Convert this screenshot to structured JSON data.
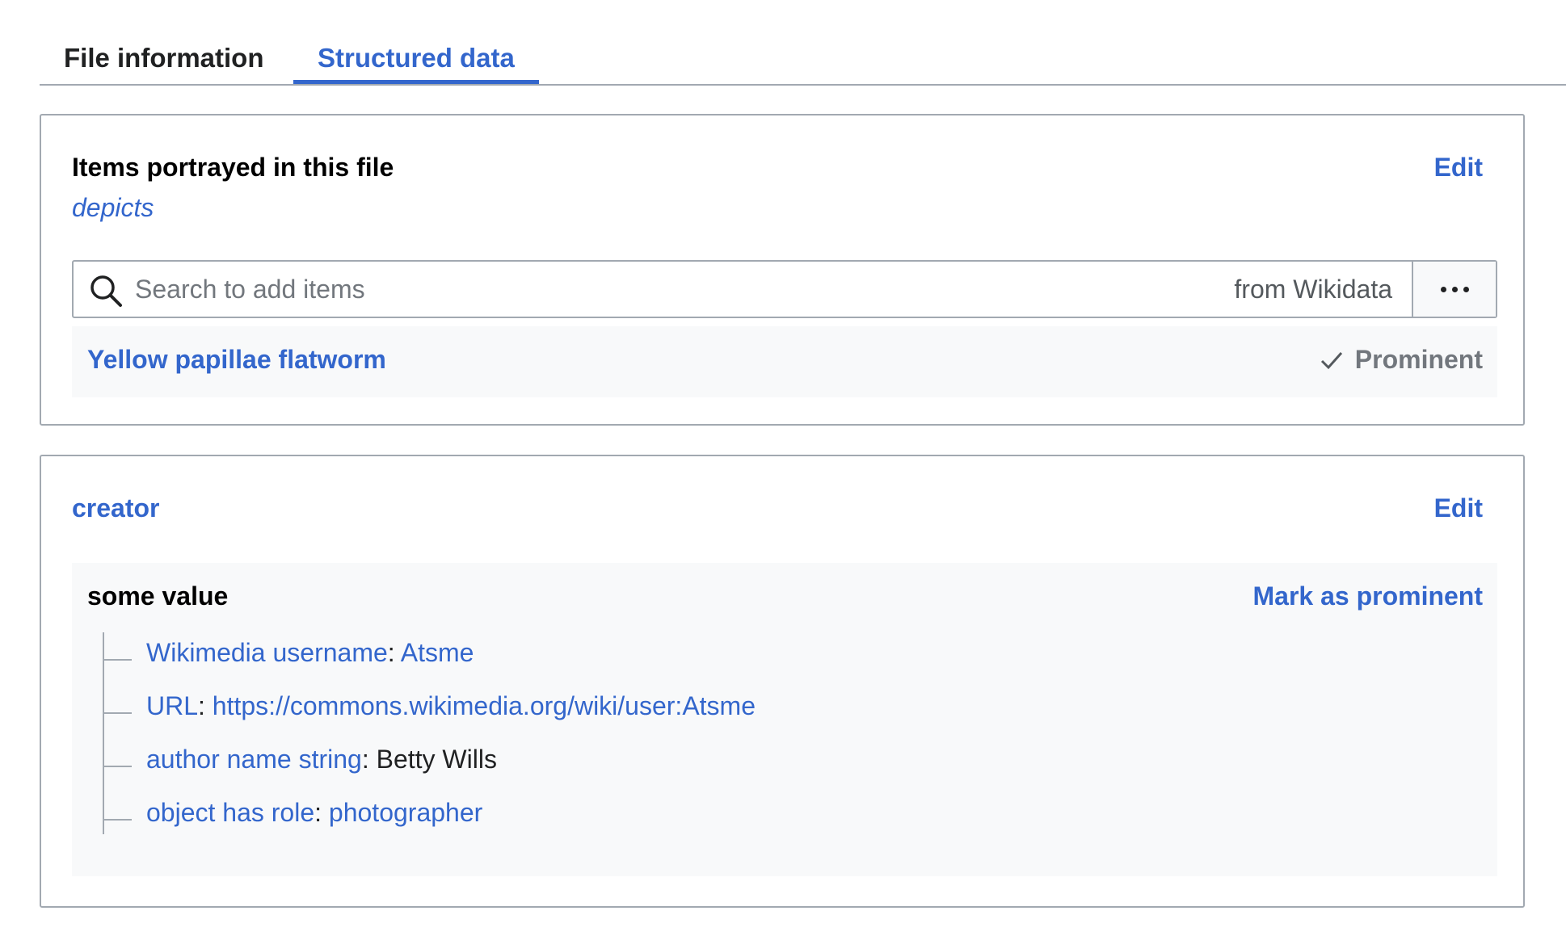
{
  "tabs": [
    {
      "label": "File information",
      "active": false
    },
    {
      "label": "Structured data",
      "active": true
    }
  ],
  "depicts_panel": {
    "title": "Items portrayed in this file",
    "property": "depicts",
    "edit_label": "Edit",
    "search": {
      "placeholder": "Search to add items",
      "source_label": "from Wikidata",
      "icon": "search-icon",
      "more_icon": "ellipsis-icon"
    },
    "value": {
      "label": "Yellow papillae flatworm",
      "rank_label": "Prominent",
      "rank_icon": "check-icon"
    }
  },
  "creator_panel": {
    "title": "creator",
    "edit_label": "Edit",
    "value_label": "some value",
    "mark_prominent_label": "Mark as prominent",
    "qualifiers": [
      {
        "property": "Wikimedia username",
        "separator": ":",
        "value": "Atsme",
        "value_is_link": true
      },
      {
        "property": "URL",
        "separator": ":",
        "value": "https://commons.wikimedia.org/wiki/user:Atsme",
        "value_is_link": true
      },
      {
        "property": "author name string",
        "separator": ":",
        "value": "Betty Wills",
        "value_is_link": false
      },
      {
        "property": "object has role",
        "separator": ":",
        "value": "photographer",
        "value_is_link": true
      }
    ]
  },
  "colors": {
    "link": "#3366cc",
    "border": "#a2a9b1",
    "subtle_bg": "#f8f9fa",
    "muted_text": "#72777d"
  }
}
